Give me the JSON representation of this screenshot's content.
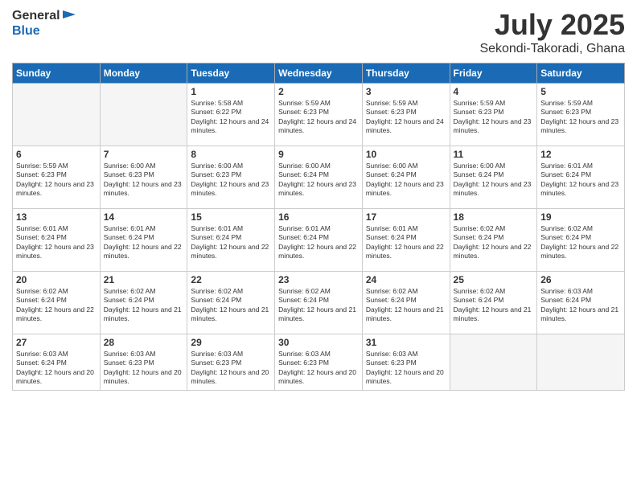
{
  "logo": {
    "line1": "General",
    "line2": "Blue"
  },
  "title": "July 2025",
  "location": "Sekondi-Takoradi, Ghana",
  "days_of_week": [
    "Sunday",
    "Monday",
    "Tuesday",
    "Wednesday",
    "Thursday",
    "Friday",
    "Saturday"
  ],
  "weeks": [
    [
      {
        "day": "",
        "info": ""
      },
      {
        "day": "",
        "info": ""
      },
      {
        "day": "1",
        "info": "Sunrise: 5:58 AM\nSunset: 6:22 PM\nDaylight: 12 hours and 24 minutes."
      },
      {
        "day": "2",
        "info": "Sunrise: 5:59 AM\nSunset: 6:23 PM\nDaylight: 12 hours and 24 minutes."
      },
      {
        "day": "3",
        "info": "Sunrise: 5:59 AM\nSunset: 6:23 PM\nDaylight: 12 hours and 24 minutes."
      },
      {
        "day": "4",
        "info": "Sunrise: 5:59 AM\nSunset: 6:23 PM\nDaylight: 12 hours and 23 minutes."
      },
      {
        "day": "5",
        "info": "Sunrise: 5:59 AM\nSunset: 6:23 PM\nDaylight: 12 hours and 23 minutes."
      }
    ],
    [
      {
        "day": "6",
        "info": "Sunrise: 5:59 AM\nSunset: 6:23 PM\nDaylight: 12 hours and 23 minutes."
      },
      {
        "day": "7",
        "info": "Sunrise: 6:00 AM\nSunset: 6:23 PM\nDaylight: 12 hours and 23 minutes."
      },
      {
        "day": "8",
        "info": "Sunrise: 6:00 AM\nSunset: 6:23 PM\nDaylight: 12 hours and 23 minutes."
      },
      {
        "day": "9",
        "info": "Sunrise: 6:00 AM\nSunset: 6:24 PM\nDaylight: 12 hours and 23 minutes."
      },
      {
        "day": "10",
        "info": "Sunrise: 6:00 AM\nSunset: 6:24 PM\nDaylight: 12 hours and 23 minutes."
      },
      {
        "day": "11",
        "info": "Sunrise: 6:00 AM\nSunset: 6:24 PM\nDaylight: 12 hours and 23 minutes."
      },
      {
        "day": "12",
        "info": "Sunrise: 6:01 AM\nSunset: 6:24 PM\nDaylight: 12 hours and 23 minutes."
      }
    ],
    [
      {
        "day": "13",
        "info": "Sunrise: 6:01 AM\nSunset: 6:24 PM\nDaylight: 12 hours and 23 minutes."
      },
      {
        "day": "14",
        "info": "Sunrise: 6:01 AM\nSunset: 6:24 PM\nDaylight: 12 hours and 22 minutes."
      },
      {
        "day": "15",
        "info": "Sunrise: 6:01 AM\nSunset: 6:24 PM\nDaylight: 12 hours and 22 minutes."
      },
      {
        "day": "16",
        "info": "Sunrise: 6:01 AM\nSunset: 6:24 PM\nDaylight: 12 hours and 22 minutes."
      },
      {
        "day": "17",
        "info": "Sunrise: 6:01 AM\nSunset: 6:24 PM\nDaylight: 12 hours and 22 minutes."
      },
      {
        "day": "18",
        "info": "Sunrise: 6:02 AM\nSunset: 6:24 PM\nDaylight: 12 hours and 22 minutes."
      },
      {
        "day": "19",
        "info": "Sunrise: 6:02 AM\nSunset: 6:24 PM\nDaylight: 12 hours and 22 minutes."
      }
    ],
    [
      {
        "day": "20",
        "info": "Sunrise: 6:02 AM\nSunset: 6:24 PM\nDaylight: 12 hours and 22 minutes."
      },
      {
        "day": "21",
        "info": "Sunrise: 6:02 AM\nSunset: 6:24 PM\nDaylight: 12 hours and 21 minutes."
      },
      {
        "day": "22",
        "info": "Sunrise: 6:02 AM\nSunset: 6:24 PM\nDaylight: 12 hours and 21 minutes."
      },
      {
        "day": "23",
        "info": "Sunrise: 6:02 AM\nSunset: 6:24 PM\nDaylight: 12 hours and 21 minutes."
      },
      {
        "day": "24",
        "info": "Sunrise: 6:02 AM\nSunset: 6:24 PM\nDaylight: 12 hours and 21 minutes."
      },
      {
        "day": "25",
        "info": "Sunrise: 6:02 AM\nSunset: 6:24 PM\nDaylight: 12 hours and 21 minutes."
      },
      {
        "day": "26",
        "info": "Sunrise: 6:03 AM\nSunset: 6:24 PM\nDaylight: 12 hours and 21 minutes."
      }
    ],
    [
      {
        "day": "27",
        "info": "Sunrise: 6:03 AM\nSunset: 6:24 PM\nDaylight: 12 hours and 20 minutes."
      },
      {
        "day": "28",
        "info": "Sunrise: 6:03 AM\nSunset: 6:23 PM\nDaylight: 12 hours and 20 minutes."
      },
      {
        "day": "29",
        "info": "Sunrise: 6:03 AM\nSunset: 6:23 PM\nDaylight: 12 hours and 20 minutes."
      },
      {
        "day": "30",
        "info": "Sunrise: 6:03 AM\nSunset: 6:23 PM\nDaylight: 12 hours and 20 minutes."
      },
      {
        "day": "31",
        "info": "Sunrise: 6:03 AM\nSunset: 6:23 PM\nDaylight: 12 hours and 20 minutes."
      },
      {
        "day": "",
        "info": ""
      },
      {
        "day": "",
        "info": ""
      }
    ]
  ]
}
